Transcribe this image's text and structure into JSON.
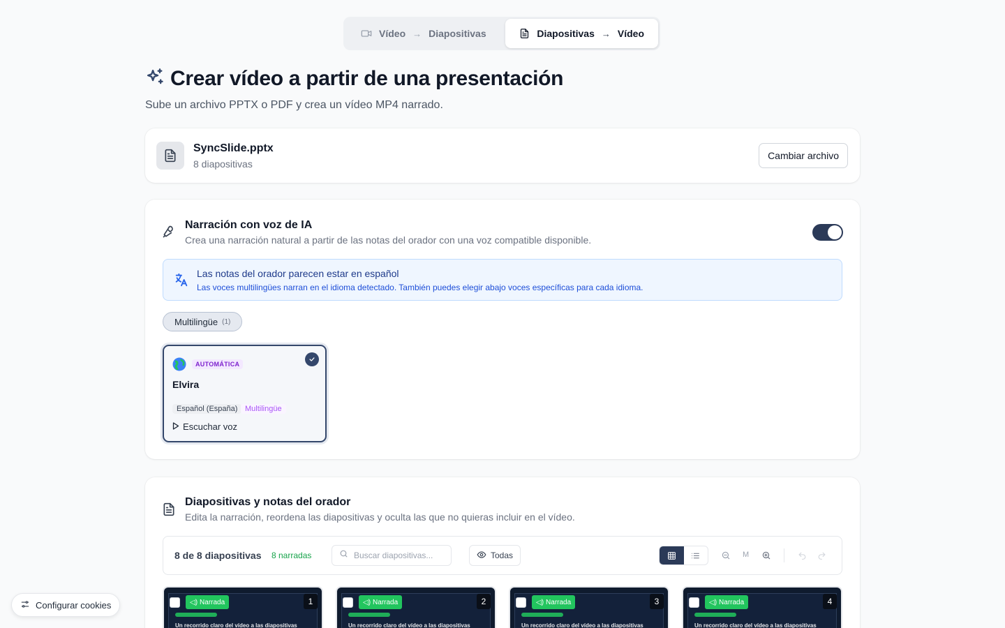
{
  "switcher": {
    "tab1": {
      "from": "Vídeo",
      "to": "Diapositivas"
    },
    "tab2": {
      "from": "Diapositivas",
      "to": "Vídeo"
    }
  },
  "header": {
    "title": "Crear vídeo a partir de una presentación",
    "subtitle": "Sube un archivo PPTX o PDF y crea un vídeo MP4 narrado."
  },
  "file": {
    "name": "SyncSlide.pptx",
    "count": "8 diapositivas",
    "change_label": "Cambiar archivo"
  },
  "narration": {
    "title": "Narración con voz de IA",
    "description": "Crea una narración natural a partir de las notas del orador con una voz compatible disponible.",
    "enabled": true,
    "banner_title": "Las notas del orador parecen estar en español",
    "banner_text": "Las voces multilingües narran en el idioma detectado. También puedes elegir abajo voces específicas para cada idioma.",
    "filter_label": "Multilingüe",
    "filter_count": "(1)",
    "voice": {
      "badge": "AUTOMÁTICA",
      "name": "Elvira",
      "language": "Español (España)",
      "tag": "Multilingüe",
      "listen_label": "Escuchar voz"
    }
  },
  "slides": {
    "title": "Diapositivas y notas del orador",
    "description": "Edita la narración, reordena las diapositivas y oculta las que no quieras incluir en el vídeo.",
    "count_label": "8 de 8 diapositivas",
    "narrated_label": "8 narradas",
    "search_placeholder": "Buscar diapositivas...",
    "filter_label": "Todas",
    "zoom_label": "M",
    "thumbnails": [
      {
        "badge": "Narrada",
        "number": "1",
        "caption": "Un recorrido claro del vídeo a las diapositivas"
      },
      {
        "badge": "Narrada",
        "number": "2",
        "caption": "Un recorrido claro del vídeo a las diapositivas"
      },
      {
        "badge": "Narrada",
        "number": "3",
        "caption": "Un recorrido claro del vídeo a las diapositivas"
      },
      {
        "badge": "Narrada",
        "number": "4",
        "caption": "Un recorrido claro del vídeo a las diapositivas"
      }
    ]
  },
  "cookies": {
    "label": "Configurar cookies"
  },
  "colors": {
    "accent": "#2b3a58",
    "success": "#22c55e",
    "info_bg": "#eff6ff",
    "purple": "#a855f7"
  }
}
